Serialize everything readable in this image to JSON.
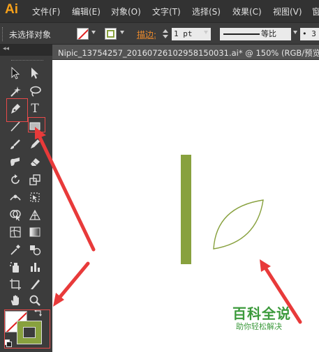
{
  "app": {
    "logo": "Ai",
    "menu": [
      "文件(F)",
      "编辑(E)",
      "对象(O)",
      "文字(T)",
      "选择(S)",
      "效果(C)",
      "视图(V)",
      "窗"
    ]
  },
  "control_bar": {
    "selection_status": "未选择对象",
    "stroke_label": "描边:",
    "stroke_weight": "1 pt",
    "stroke_profile": "等比",
    "bullet_field": "•  3"
  },
  "document_tab": {
    "title": "Nipic_13754257_20160726102958150031.ai*  @  150%  (RGB/预览)",
    "close": "×"
  },
  "toolbox": {
    "collapse_arrows": "◂◂",
    "tools": [
      {
        "name": "selection-tool-icon"
      },
      {
        "name": "direct-selection-tool-icon"
      },
      {
        "name": "magic-wand-tool-icon"
      },
      {
        "name": "lasso-tool-icon"
      },
      {
        "name": "pen-tool-icon"
      },
      {
        "name": "type-tool-icon",
        "label": "T"
      },
      {
        "name": "line-tool-icon"
      },
      {
        "name": "rectangle-tool-icon"
      },
      {
        "name": "paintbrush-tool-icon"
      },
      {
        "name": "pencil-tool-icon"
      },
      {
        "name": "blob-brush-tool-icon"
      },
      {
        "name": "eraser-tool-icon"
      },
      {
        "name": "rotate-tool-icon"
      },
      {
        "name": "scale-tool-icon"
      },
      {
        "name": "width-tool-icon"
      },
      {
        "name": "free-transform-tool-icon"
      },
      {
        "name": "shape-builder-tool-icon"
      },
      {
        "name": "perspective-grid-tool-icon"
      },
      {
        "name": "mesh-tool-icon"
      },
      {
        "name": "gradient-tool-icon"
      },
      {
        "name": "eyedropper-tool-icon"
      },
      {
        "name": "blend-tool-icon"
      },
      {
        "name": "symbol-sprayer-tool-icon"
      },
      {
        "name": "column-graph-tool-icon"
      },
      {
        "name": "artboard-tool-icon"
      },
      {
        "name": "slice-tool-icon"
      },
      {
        "name": "hand-tool-icon"
      },
      {
        "name": "zoom-tool-icon"
      }
    ]
  },
  "colors": {
    "fill": "none",
    "stroke": "#88a13e",
    "shape_green": "#88a13e",
    "highlight_red": "#e84a4a",
    "watermark_green": "#3c9a3c"
  },
  "watermark": {
    "title": "百科全说",
    "subtitle": "助你轻松解决"
  }
}
